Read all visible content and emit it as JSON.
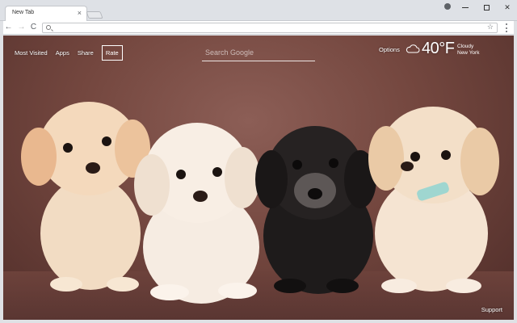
{
  "browser": {
    "tab_title": "New Tab",
    "tab_close": "×",
    "url": "",
    "nav": {
      "back": "←",
      "forward": "→",
      "reload": "C"
    },
    "controls": {
      "close": "✕"
    },
    "star": "☆"
  },
  "newtab": {
    "nav_links": [
      "Most Visited",
      "Apps",
      "Share"
    ],
    "rate_label": "Rate",
    "search_placeholder": "Search Google",
    "options_label": "Options",
    "weather": {
      "temperature": "40°F",
      "condition": "Cloudy",
      "location": "New York"
    },
    "support_label": "Support",
    "background_subject": "four-poodle-puppies"
  },
  "colors": {
    "background": "#74473f",
    "text": "#ffffff"
  }
}
